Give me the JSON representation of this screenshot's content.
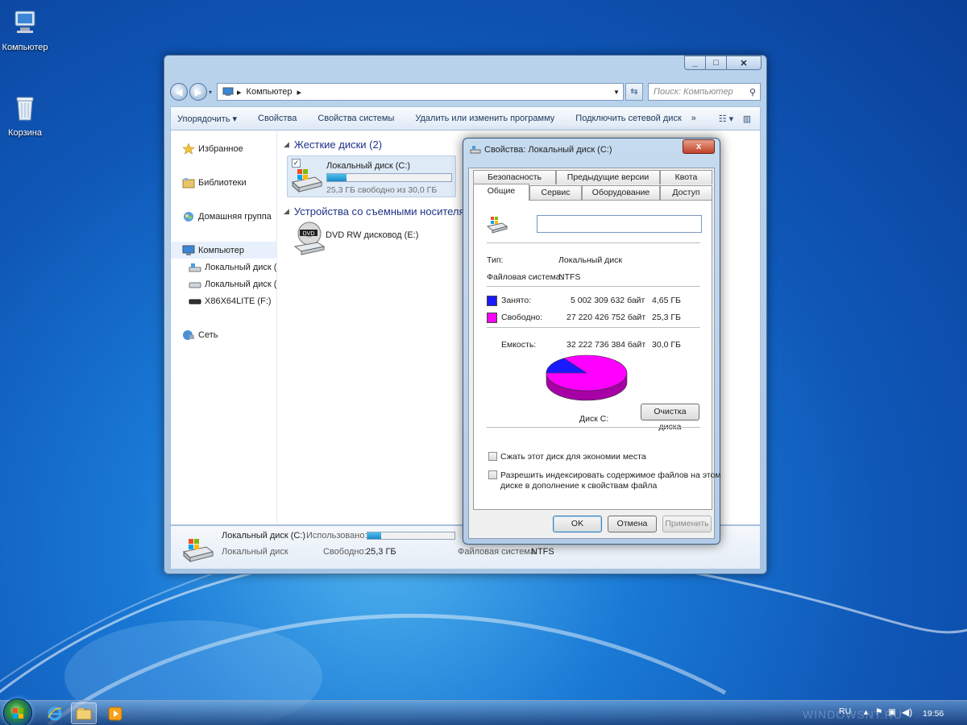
{
  "desktop": {
    "icons": [
      {
        "label": "Компьютер"
      },
      {
        "label": "Корзина"
      }
    ]
  },
  "explorer": {
    "address": {
      "root_glyph": "▸",
      "crumb": "Компьютер",
      "sep": "▸"
    },
    "search_placeholder": "Поиск: Компьютер",
    "toolbar": {
      "organize": "Упорядочить ▾",
      "properties": "Свойства",
      "system_properties": "Свойства системы",
      "uninstall": "Удалить или изменить программу",
      "map_drive": "Подключить сетевой диск",
      "more": "»"
    },
    "nav": {
      "favorites": "Избранное",
      "libraries": "Библиотеки",
      "homegroup": "Домашняя группа",
      "computer": "Компьютер",
      "drive_c": "Локальный диск (С",
      "drive_d": "Локальный диск (D",
      "usb": "X86X64LITE (F:)",
      "network": "Сеть"
    },
    "hard_disks_header": "Жесткие диски (2)",
    "removable_header": "Устройства со съемными носителям",
    "drive_c": {
      "name": "Локальный диск (C:)",
      "free_text": "25,3 ГБ свободно из 30,0 ГБ",
      "used_fraction": 0.155
    },
    "dvd": {
      "name": "DVD RW дисковод (E:)"
    },
    "details": {
      "name": "Локальный диск (C:)",
      "type": "Локальный диск",
      "used_label": "Использовано:",
      "free_label": "Свободно:",
      "free_value": "25,3 ГБ",
      "fs_label": "Файловая система:",
      "fs_value": "NTFS"
    }
  },
  "dialog": {
    "title": "Свойства: Локальный диск (C:)",
    "close": "x",
    "tabs_back": [
      "Безопасность",
      "Предыдущие версии",
      "Квота"
    ],
    "tabs_front": [
      "Общие",
      "Сервис",
      "Оборудование",
      "Доступ"
    ],
    "name_value": "",
    "type_label": "Тип:",
    "type_value": "Локальный диск",
    "fs_label": "Файловая система:",
    "fs_value": "NTFS",
    "used_label": "Занято:",
    "used_bytes": "5 002 309 632 байт",
    "used_gb": "4,65 ГБ",
    "free_label": "Свободно:",
    "free_bytes": "27 220 426 752 байт",
    "free_gb": "25,3 ГБ",
    "capacity_label": "Емкость:",
    "capacity_bytes": "32 222 736 384 байт",
    "capacity_gb": "30,0 ГБ",
    "disk_label": "Диск C:",
    "cleanup_button": "Очистка диска",
    "compress_label": "Сжать этот диск для экономии места",
    "index_label_1": "Разрешить индексировать содержимое файлов на этом",
    "index_label_2": "диске в дополнение к свойствам файла",
    "ok": "OK",
    "cancel": "Отмена",
    "apply": "Применить",
    "used_fraction": 0.155,
    "colors": {
      "used": "#1a1aff",
      "free": "#ff00ff"
    }
  },
  "taskbar": {
    "lang": "RU",
    "time": "19:56",
    "watermark": "WINDOWSNT.RU"
  }
}
